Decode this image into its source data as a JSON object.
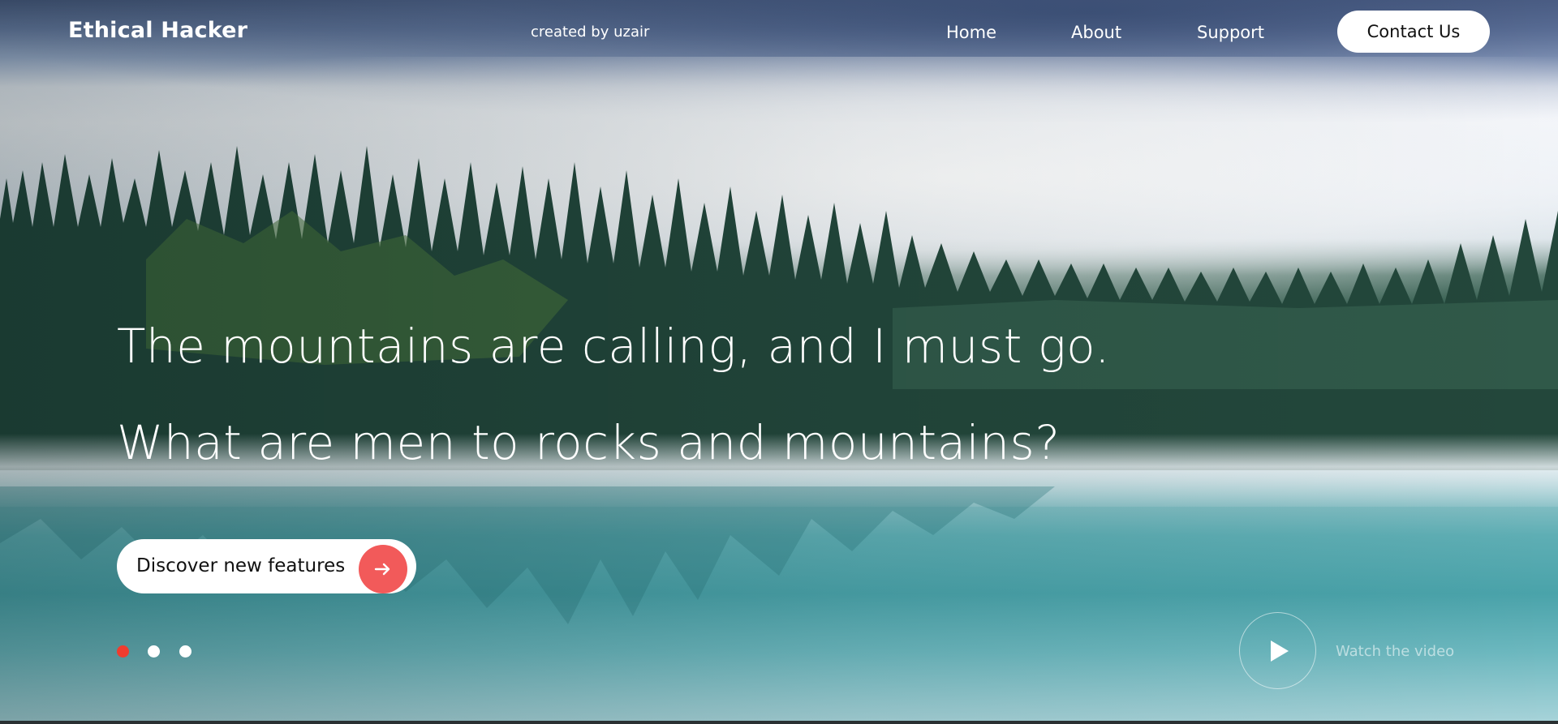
{
  "header": {
    "brand": "Ethical Hacker",
    "credit": "created by uzair",
    "nav": [
      {
        "label": "Home"
      },
      {
        "label": "About"
      },
      {
        "label": "Support"
      }
    ],
    "contact_label": "Contact Us"
  },
  "hero": {
    "line1": "The mountains are calling, and I must go.",
    "line2": "What are men to rocks and mountains?",
    "cta_label": "Discover new features",
    "cta_icon": "arrow-right-icon",
    "slider_dots": 3,
    "active_dot": 1,
    "watch_label": "Watch the video"
  },
  "colors": {
    "accent": "#f25a5a",
    "active_dot": "#f03c2e",
    "text": "#ffffff"
  }
}
